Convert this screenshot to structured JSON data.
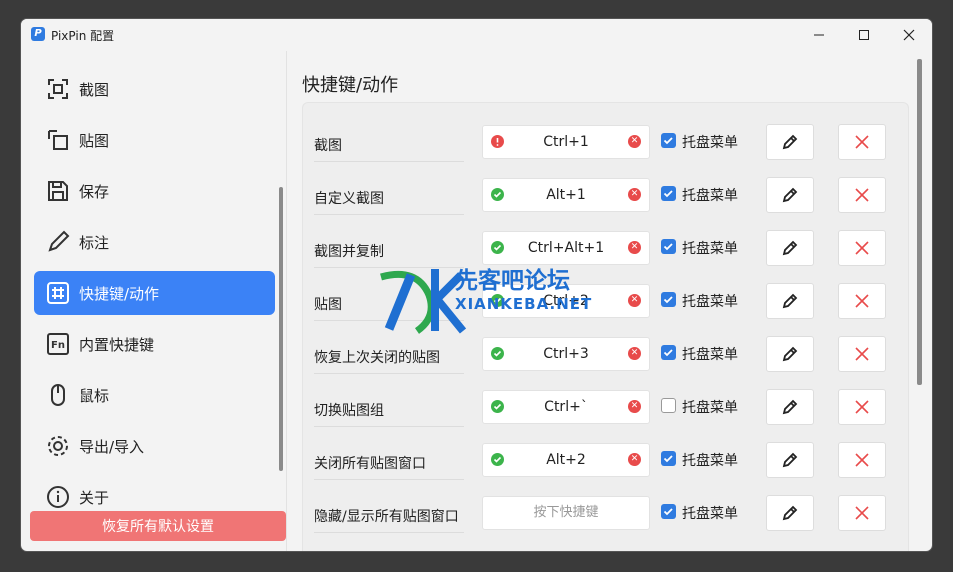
{
  "window": {
    "title": "PixPin 配置",
    "app_icon": "P",
    "min_icon": "minimize-icon",
    "max_icon": "maximize-icon",
    "close_icon": "close-icon"
  },
  "sidebar": {
    "items": [
      {
        "label": "截图",
        "icon": "screenshot-icon"
      },
      {
        "label": "贴图",
        "icon": "pin-icon"
      },
      {
        "label": "保存",
        "icon": "save-icon"
      },
      {
        "label": "标注",
        "icon": "pen-icon"
      },
      {
        "label": "快捷键/动作",
        "icon": "hotkey-icon",
        "active": true
      },
      {
        "label": "内置快捷键",
        "icon": "fn-icon"
      },
      {
        "label": "鼠标",
        "icon": "mouse-icon"
      },
      {
        "label": "导出/导入",
        "icon": "gear-icon"
      },
      {
        "label": "关于",
        "icon": "info-icon"
      }
    ],
    "reset_label": "恢复所有默认设置"
  },
  "main": {
    "heading": "快捷键/动作",
    "tray_label": "托盘菜单",
    "rows": [
      {
        "label": "截图",
        "key": "Ctrl+1",
        "status": "error",
        "tray": true
      },
      {
        "label": "自定义截图",
        "key": "Alt+1",
        "status": "ok",
        "tray": true
      },
      {
        "label": "截图并复制",
        "key": "Ctrl+Alt+1",
        "status": "ok",
        "tray": true
      },
      {
        "label": "贴图",
        "key": "Ctrl+2",
        "status": "ok",
        "tray": true
      },
      {
        "label": "恢复上次关闭的贴图",
        "key": "Ctrl+3",
        "status": "ok",
        "tray": true
      },
      {
        "label": "切换贴图组",
        "key": "Ctrl+`",
        "status": "ok",
        "tray": false
      },
      {
        "label": "关闭所有贴图窗口",
        "key": "Alt+2",
        "status": "ok",
        "tray": true
      },
      {
        "label": "隐藏/显示所有贴图窗口",
        "key": "",
        "placeholder": "按下快捷键",
        "status": "none",
        "tray": true
      }
    ]
  },
  "watermark": {
    "title": "先客吧论坛",
    "url": "XIANKEBA.NET"
  },
  "colors": {
    "accent": "#3b82f6",
    "reset": "#f07575",
    "ok": "#3cb44b",
    "error": "#e84b4b",
    "delete": "#e84b4b"
  }
}
